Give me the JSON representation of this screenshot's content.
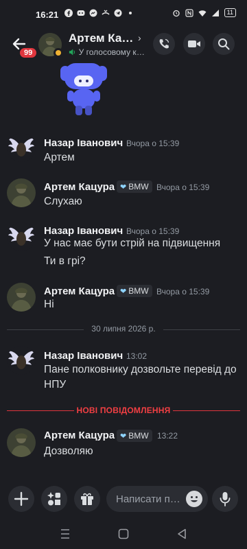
{
  "status": {
    "time": "16:21",
    "battery": "11"
  },
  "header": {
    "unread_badge": "99",
    "name": "Артем Кацура",
    "status_text": "У голосовому каналі",
    "status_color": "#23a55a"
  },
  "messages": [
    {
      "author": "Назар Іванович",
      "time": "Вчора о 15:39",
      "lines": [
        "Артем"
      ],
      "avatar": "wings",
      "role": ""
    },
    {
      "author": "Артем Кацура",
      "time": "Вчора о 15:39",
      "lines": [
        "Слухаю"
      ],
      "avatar": "soldier",
      "role": "BMW"
    },
    {
      "author": "Назар Іванович",
      "time": "Вчора о 15:39",
      "lines": [
        "У нас має бути стрій на підвищення",
        "Ти в грі?"
      ],
      "avatar": "wings",
      "role": ""
    },
    {
      "author": "Артем Кацура",
      "time": "Вчора о 15:39",
      "lines": [
        "Ні"
      ],
      "avatar": "soldier",
      "role": "BMW"
    },
    {
      "author": "Назар Іванович",
      "time": "13:02",
      "lines": [
        "Пане полковнику дозвольте перевід до НПУ"
      ],
      "avatar": "wings",
      "role": ""
    },
    {
      "author": "Артем Кацура",
      "time": "13:22",
      "lines": [
        "Дозволяю"
      ],
      "avatar": "soldier",
      "role": "BMW"
    }
  ],
  "dividers": {
    "date": "30 липня 2026 р.",
    "new_messages": "НОВІ ПОВІДОМЛЕННЯ"
  },
  "composer": {
    "placeholder": "Написати повідомлення"
  },
  "colors": {
    "background": "#1c1d22",
    "accent_red": "#f23f43",
    "sticker_blue": "#5865f2"
  }
}
